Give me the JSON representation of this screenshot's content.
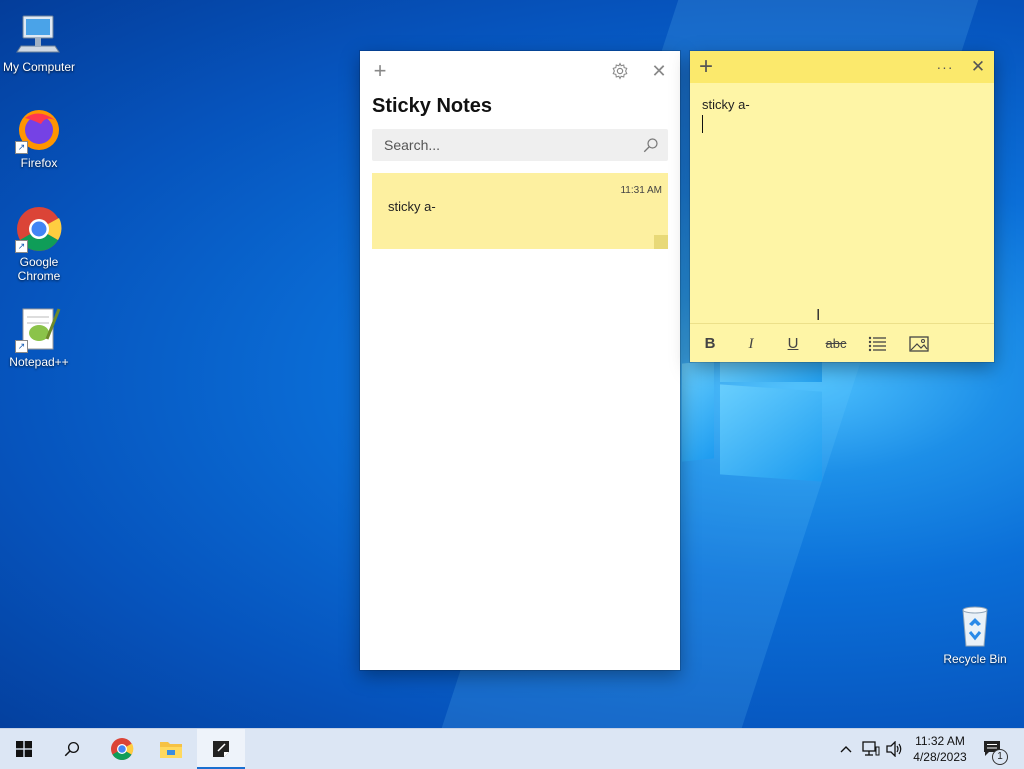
{
  "desktop": {
    "icons": [
      {
        "label": "My Computer"
      },
      {
        "label": "Firefox"
      },
      {
        "label": "Google Chrome"
      },
      {
        "label": "Notepad++"
      },
      {
        "label": "Recycle Bin"
      }
    ]
  },
  "notes_list": {
    "title": "Sticky Notes",
    "search_placeholder": "Search...",
    "notes": [
      {
        "time": "11:31 AM",
        "text": "sticky a-"
      }
    ]
  },
  "note_window": {
    "body_text": "sticky a-",
    "toolbar": [
      "B",
      "I",
      "U",
      "abc"
    ],
    "colors": {
      "bar": "#fbe96c",
      "body": "#fef5a6"
    }
  },
  "taskbar": {
    "time": "11:32 AM",
    "date": "4/28/2023",
    "notification_count": "1"
  },
  "icons": {
    "add": "+",
    "close": "✕",
    "more": "···"
  }
}
